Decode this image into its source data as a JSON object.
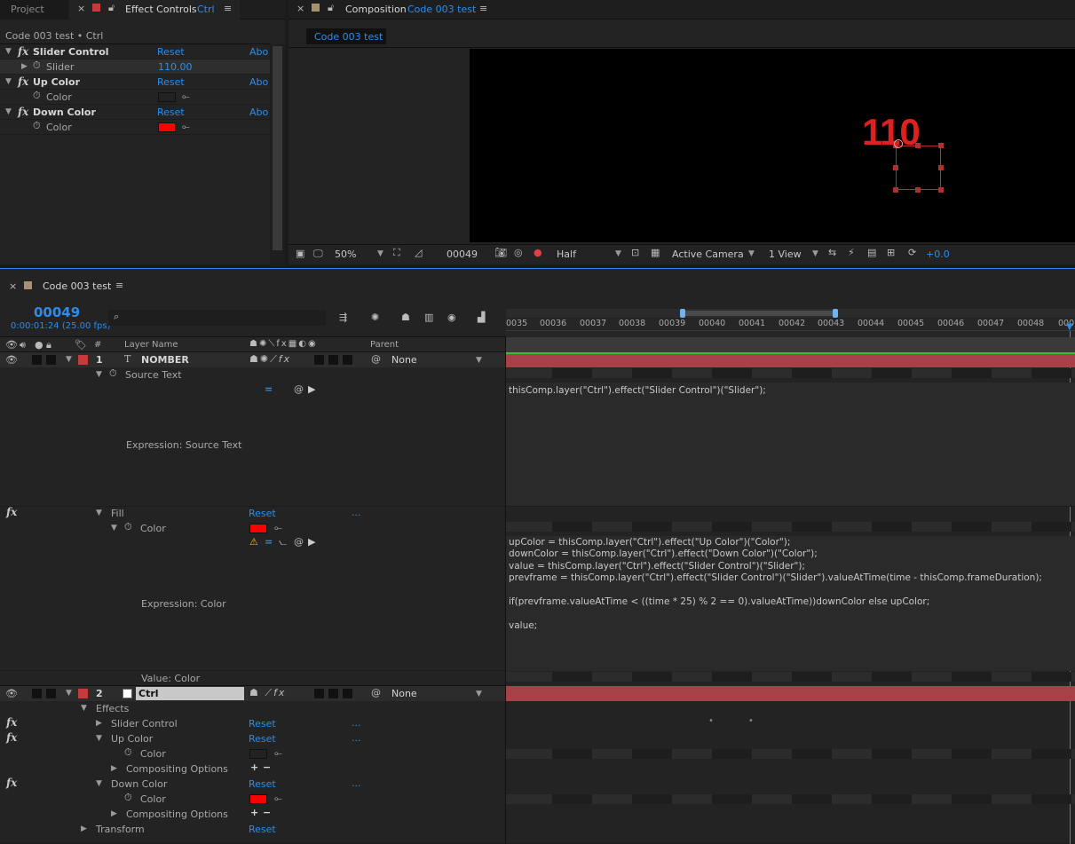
{
  "effect_controls": {
    "project_tab": "Project",
    "tab_title": "Effect Controls",
    "tab_layer": "Ctrl",
    "breadcrumb": "Code 003 test • Ctrl",
    "rows": [
      {
        "name": "Slider Control",
        "reset": "Reset",
        "about": "Abo"
      },
      {
        "name": "Slider",
        "value": "110.00"
      },
      {
        "name": "Up Color",
        "reset": "Reset",
        "about": "Abo"
      },
      {
        "name": "Color"
      },
      {
        "name": "Down Color",
        "reset": "Reset",
        "about": "Abo"
      },
      {
        "name": "Color"
      }
    ]
  },
  "composition": {
    "tab_title": "Composition",
    "tab_comp": "Code 003 test",
    "subtab": "Code 003 test",
    "canvas_text": "110",
    "zoom": "50%",
    "timecode": "00049",
    "resolution": "Half",
    "camera": "Active Camera",
    "views": "1 View",
    "exposure": "+0.0"
  },
  "timeline": {
    "tab_title": "Code 003 test",
    "current_frame": "00049",
    "current_time": "0:00:01:24 (25.00 fps)",
    "search_placeholder": "",
    "ruler_labels": [
      "0035",
      "00036",
      "00037",
      "00038",
      "00039",
      "00040",
      "00041",
      "00042",
      "00043",
      "00044",
      "00045",
      "00046",
      "00047",
      "00048",
      "000"
    ],
    "col_hash": "#",
    "col_layer_name": "Layer Name",
    "col_parent": "Parent",
    "layer1": {
      "index": "1",
      "name": "NOMBER",
      "parent": "None"
    },
    "source_text": "Source Text",
    "expr_source_text": "Expression: Source Text",
    "fill": "Fill",
    "fill_reset": "Reset",
    "fill_more": "...",
    "fill_color": "Color",
    "expr_color": "Expression: Color",
    "value_color": "Value: Color",
    "layer2": {
      "index": "2",
      "name": "Ctrl",
      "parent": "None"
    },
    "effects": "Effects",
    "slider_control": "Slider Control",
    "up_color": "Up Color",
    "down_color": "Down Color",
    "color": "Color",
    "compositing_options": "Compositing Options",
    "transform": "Transform",
    "reset": "Reset",
    "more": "...",
    "code_source_text": "thisComp.layer(\"Ctrl\").effect(\"Slider Control\")(\"Slider\");",
    "code_color": [
      "upColor = thisComp.layer(\"Ctrl\").effect(\"Up Color\")(\"Color\");",
      "downColor = thisComp.layer(\"Ctrl\").effect(\"Down Color\")(\"Color\");",
      "value = thisComp.layer(\"Ctrl\").effect(\"Slider Control\")(\"Slider\");",
      "prevframe = thisComp.layer(\"Ctrl\").effect(\"Slider Control\")(\"Slider\").valueAtTime(time - thisComp.frameDuration);",
      "",
      "if(prevframe.valueAtTime < ((time * 25) % 2 == 0).valueAtTime))downColor else upColor;",
      "",
      "value;"
    ]
  },
  "colors": {
    "accent": "#2d8ceb",
    "label_red": "#c53a3a",
    "swatch_red": "#ff0000",
    "layer_bar": "#a64148",
    "text_red": "#e0201e"
  }
}
